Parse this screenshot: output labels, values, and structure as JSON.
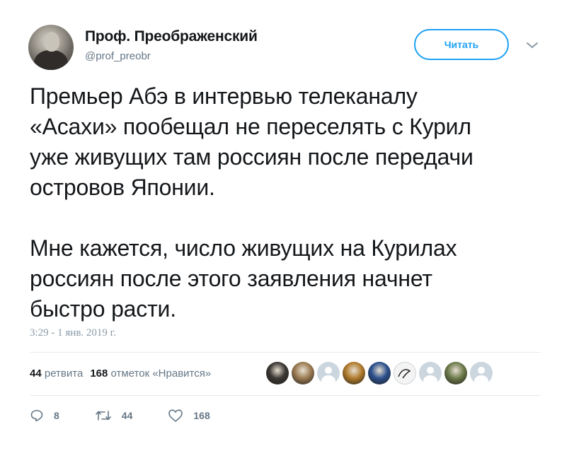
{
  "author": {
    "name": "Проф. Преображенский",
    "handle": "@prof_preobr"
  },
  "follow_button_label": "Читать",
  "tweet": {
    "text": "Премьер Абэ в интервью телеканалу\n«Асахи» пообещал не переселять с Курил\nуже живущих там россиян после передачи\nостровов Японии.\n\nМне кажется, число живущих на Курилах\nроссиян после этого заявления начнет\nбыстро расти.",
    "timestamp": "3:29 - 1 янв. 2019 г."
  },
  "stats": {
    "retweets_count": "44",
    "retweets_label": "ретвита",
    "likes_count": "168",
    "likes_label": "отметок «Нравится»"
  },
  "likers": [
    {
      "style": "photo",
      "color": "#3a3633"
    },
    {
      "style": "photo",
      "color": "#9a7a52"
    },
    {
      "style": "default",
      "color": "#cbd6df"
    },
    {
      "style": "photo",
      "color": "#b07a2c"
    },
    {
      "style": "photo",
      "color": "#2b4f8c"
    },
    {
      "style": "sketch",
      "color": "#f4f4f4"
    },
    {
      "style": "default",
      "color": "#cbd6df"
    },
    {
      "style": "photo",
      "color": "#6b7a4a"
    },
    {
      "style": "default",
      "color": "#cbd6df"
    }
  ],
  "actions": {
    "replies": "8",
    "retweets": "44",
    "likes": "168"
  },
  "colors": {
    "accent": "#1da1f2",
    "text": "#14171a",
    "muted": "#657786",
    "timestamp": "#8899a6",
    "divider": "#e6ecf0"
  }
}
